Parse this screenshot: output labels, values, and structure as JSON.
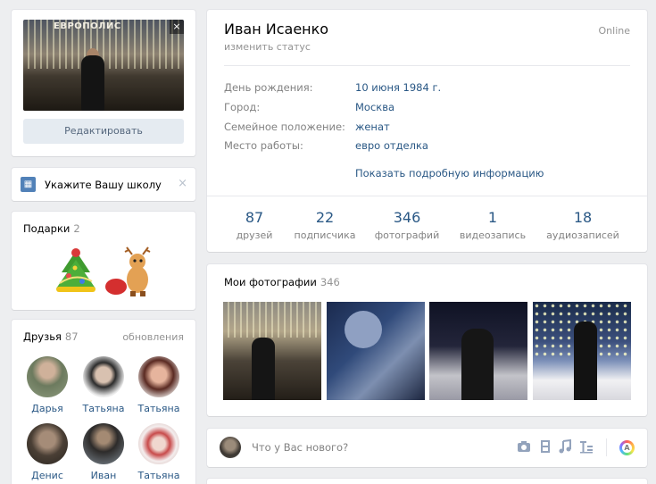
{
  "profile": {
    "name": "Иван Исаенко",
    "status_link": "изменить статус",
    "online": "Online",
    "edit_button": "Редактировать",
    "avatar_close": "×",
    "info": [
      {
        "label": "День рождения:",
        "value": "10 июня 1984 г."
      },
      {
        "label": "Город:",
        "value": "Москва"
      },
      {
        "label": "Семейное положение:",
        "value": "женат"
      },
      {
        "label": "Место работы:",
        "value": "евро отделка"
      }
    ],
    "more_info": "Показать подробную информацию",
    "counters": [
      {
        "num": "87",
        "label": "друзей"
      },
      {
        "num": "22",
        "label": "подписчика"
      },
      {
        "num": "346",
        "label": "фотографий"
      },
      {
        "num": "1",
        "label": "видеозапись"
      },
      {
        "num": "18",
        "label": "аудиозаписей"
      }
    ]
  },
  "school": {
    "text": "Укажите Вашу школу",
    "close": "×"
  },
  "gifts": {
    "title": "Подарки",
    "count": "2"
  },
  "friends": {
    "title": "Друзья",
    "count": "87",
    "updates": "обновления",
    "items": [
      {
        "name": "Дарья"
      },
      {
        "name": "Татьяна"
      },
      {
        "name": "Татьяна"
      },
      {
        "name": "Денис"
      },
      {
        "name": "Иван"
      },
      {
        "name": "Татьяна"
      }
    ]
  },
  "photos": {
    "title": "Мои фотографии",
    "count": "346"
  },
  "post": {
    "placeholder": "Что у Вас нового?"
  },
  "colors": {
    "accent": "#5181b8",
    "link": "#2a5885",
    "background": "#edeef0"
  }
}
